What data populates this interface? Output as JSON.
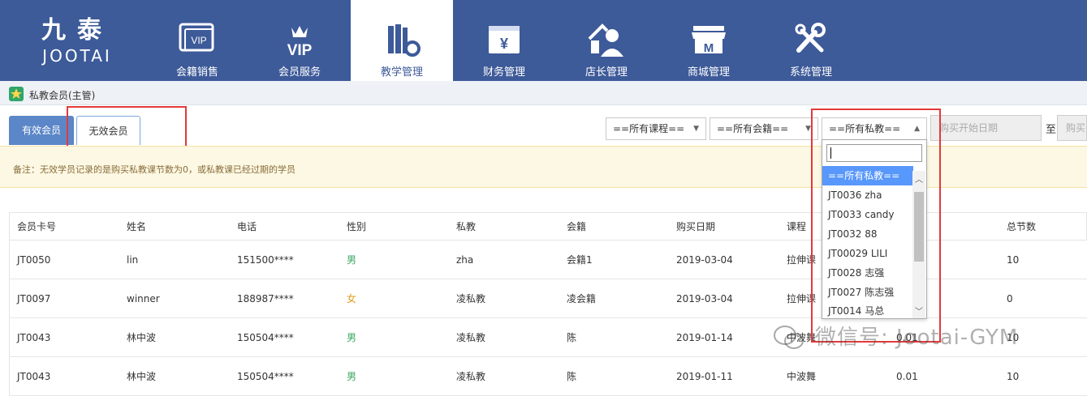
{
  "brand": {
    "name_cn": "九泰",
    "name_en": "JOOTAI"
  },
  "nav": [
    {
      "label": "会籍销售",
      "icon": "vip-card-icon"
    },
    {
      "label": "会员服务",
      "icon": "vip-crown-icon"
    },
    {
      "label": "教学管理",
      "icon": "books-gear-icon",
      "active": true
    },
    {
      "label": "财务管理",
      "icon": "yen-register-icon"
    },
    {
      "label": "店长管理",
      "icon": "manager-icon"
    },
    {
      "label": "商城管理",
      "icon": "shop-icon"
    },
    {
      "label": "系统管理",
      "icon": "tools-icon"
    }
  ],
  "breadcrumb": "私教会员(主管)",
  "tabs": {
    "valid": "有效会员",
    "invalid": "无效会员"
  },
  "filters": {
    "course": "==所有课程==",
    "membership": "==所有会籍==",
    "coach": "==所有私教==",
    "date_start": "购买开始日期",
    "date_to": "至",
    "date_end": "购买"
  },
  "note": "备注：无效学员记录的是购买私教课节数为0，或私教课已经过期的学员",
  "table": {
    "headers": [
      "会员卡号",
      "姓名",
      "电话",
      "性别",
      "私教",
      "会籍",
      "购买日期",
      "课程",
      "",
      "总节数"
    ],
    "rows": [
      [
        "JT0050",
        "lin",
        "151500****",
        "男",
        "zha",
        "会籍1",
        "2019-03-04",
        "拉伸课",
        "",
        "10"
      ],
      [
        "JT0097",
        "winner",
        "188987****",
        "女",
        "凌私教",
        "凌会籍",
        "2019-03-04",
        "拉伸课",
        "",
        "0"
      ],
      [
        "JT0043",
        "林中波",
        "150504****",
        "男",
        "凌私教",
        "陈",
        "2019-01-14",
        "中波舞",
        "0.01",
        "10"
      ],
      [
        "JT0043",
        "林中波",
        "150504****",
        "男",
        "凌私教",
        "陈",
        "2019-01-11",
        "中波舞",
        "0.01",
        "10"
      ]
    ]
  },
  "dropdown": {
    "search_value": "",
    "options": [
      "==所有私教==",
      "JT0036 zha",
      "JT0033 candy",
      "JT0032 88",
      "JT00029 LILI",
      "JT0028 志强",
      "JT0027 陈志强",
      "JT0014 马总"
    ]
  },
  "watermark": "微信号: Jootai-GYM",
  "colors": {
    "nav_bg": "#3d5a99",
    "tab_active": "#5b86c7",
    "highlight": "#e23a3a",
    "note_bg": "#fcf8e3",
    "male": "#3aa55b",
    "female": "#e39b22"
  }
}
